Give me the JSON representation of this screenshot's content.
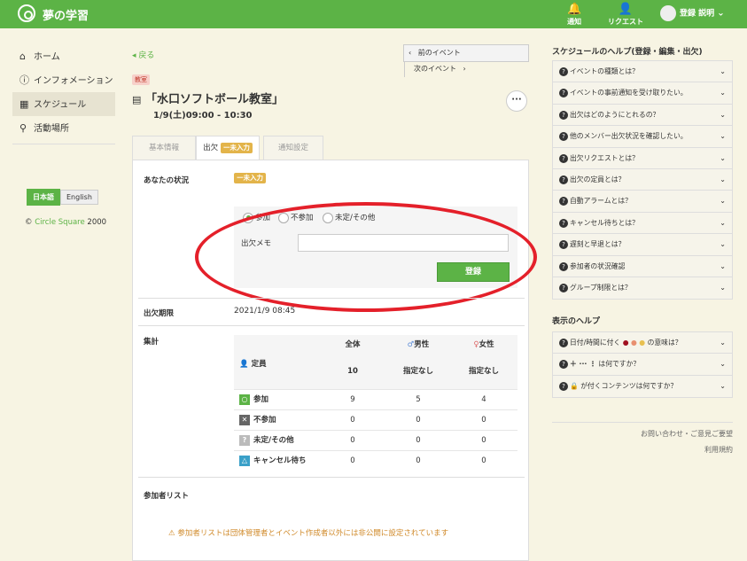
{
  "header": {
    "app_title": "夢の学習",
    "notify_label": "通知",
    "request_label": "リクエスト",
    "user_label": "登録 説明"
  },
  "sidebar": {
    "items": [
      {
        "label": "ホーム",
        "icon": "home-icon"
      },
      {
        "label": "インフォメーション",
        "icon": "info-icon"
      },
      {
        "label": "スケジュール",
        "icon": "calendar-icon"
      },
      {
        "label": "活動場所",
        "icon": "map-pin-icon"
      }
    ],
    "lang_ja": "日本語",
    "lang_en": "English",
    "copyright_prefix": "©",
    "copyright_org": "Circle Square",
    "copyright_year": "2000"
  },
  "event": {
    "back_label": "戻る",
    "prev_label": "前のイベント",
    "next_label": "次のイベント",
    "tag": "教室",
    "title": "「水口ソフトボール教室」",
    "datetime": "1/9(土)09:00 - 10:30",
    "tabs": {
      "basic": "基本情報",
      "attendance": "出欠",
      "attendance_badge": "ー未入力",
      "notify": "通知設定"
    }
  },
  "panel": {
    "your_status_label": "あなたの状況",
    "your_status_badge": "ー未入力",
    "radio_join": "参加",
    "radio_nojoin": "不参加",
    "radio_other": "未定/その他",
    "memo_label": "出欠メモ",
    "memo_value": "",
    "submit_label": "登録",
    "deadline_label": "出欠期限",
    "deadline_value": "2021/1/9 08:45",
    "stats_label": "集計",
    "cols": {
      "total": "全体",
      "male": "男性",
      "female": "女性"
    },
    "rows": [
      {
        "label": "定員",
        "total": "10",
        "male": "指定なし",
        "female": "指定なし"
      },
      {
        "label": "参加",
        "total": "9",
        "male": "5",
        "female": "4"
      },
      {
        "label": "不参加",
        "total": "0",
        "male": "0",
        "female": "0"
      },
      {
        "label": "未定/その他",
        "total": "0",
        "male": "0",
        "female": "0"
      },
      {
        "label": "キャンセル待ち",
        "total": "0",
        "male": "0",
        "female": "0"
      }
    ],
    "participants_label": "参加者リスト",
    "notice": "参加者リストは団体管理者とイベント作成者以外には非公開に設定されています"
  },
  "help": {
    "schedule_title": "スケジュールのヘルプ(登録・編集・出欠)",
    "schedule_items": [
      "イベントの種類とは？",
      "イベントの事前通知を受け取りたい。",
      "出欠はどのようにとれるの？",
      "他のメンバー出欠状況を確認したい。",
      "出欠リクエストとは？",
      "出欠の定員とは？",
      "自動アラームとは？",
      "キャンセル待ちとは？",
      "遅刻と早退とは？",
      "参加者の状況確認",
      "グループ制限とは？"
    ],
    "display_title": "表示のヘルプ",
    "display_items": [
      "日付/時間に付く",
      "の意味は？",
      "は何ですか？",
      "が付くコンテンツは何ですか？"
    ],
    "footer_contact": "お問い合わせ・ご意見ご要望",
    "footer_terms": "利用規約"
  },
  "colors": {
    "brand": "#5cb346",
    "highlight_oval": "#e4202a",
    "badge": "#e3b44a"
  }
}
